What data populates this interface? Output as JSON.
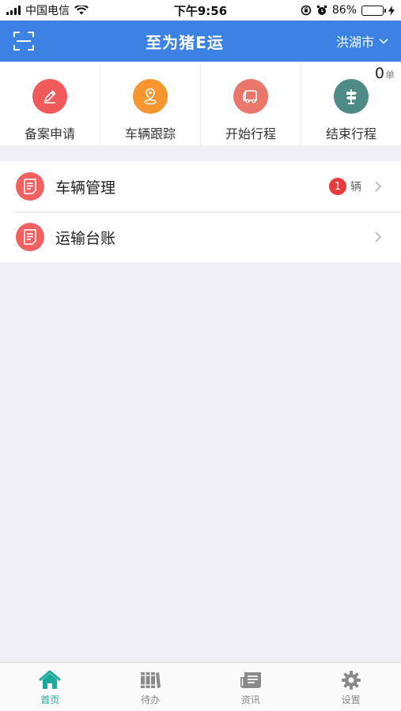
{
  "status_bar": {
    "carrier": "中国电信",
    "time": "下午9:56",
    "battery_percent": "86%",
    "battery_level": 0.86
  },
  "header": {
    "title": "至为猪E运",
    "city": "洪湖市",
    "color": "#3b82e4"
  },
  "quick_actions": {
    "items": [
      {
        "label": "备案申请",
        "icon": "edit-icon",
        "color": "#f05a5a"
      },
      {
        "label": "车辆跟踪",
        "icon": "location-pin-icon",
        "color": "#f7962f"
      },
      {
        "label": "开始行程",
        "icon": "truck-icon",
        "color": "#e9776b"
      },
      {
        "label": "结束行程",
        "icon": "signpost-icon",
        "color": "#4e8a86"
      }
    ],
    "order_count": "0",
    "order_unit": "单"
  },
  "menu": {
    "items": [
      {
        "label": "车辆管理",
        "badge": "1",
        "unit": "辆",
        "icon": "document-icon"
      },
      {
        "label": "运输台账",
        "icon": "document-icon"
      }
    ]
  },
  "tab_bar": {
    "items": [
      {
        "label": "首页",
        "icon": "home-icon",
        "active": true
      },
      {
        "label": "待办",
        "icon": "books-icon",
        "active": false
      },
      {
        "label": "资讯",
        "icon": "news-icon",
        "active": false
      },
      {
        "label": "设置",
        "icon": "gear-icon",
        "active": false
      }
    ],
    "active_color": "#1aa99a"
  }
}
